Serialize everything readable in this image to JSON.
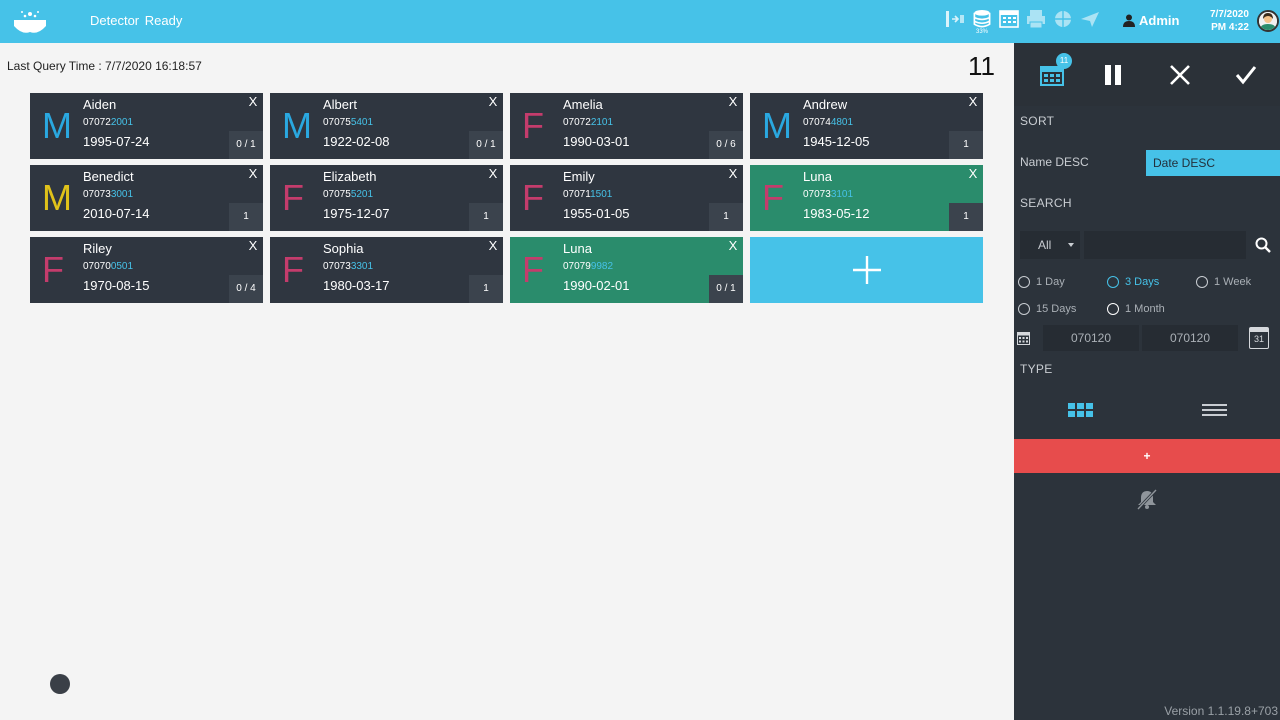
{
  "topbar": {
    "status": "Detector  Ready",
    "disk_usage": "33%",
    "user": "Admin",
    "date": "7/7/2020",
    "time": "PM 4:22",
    "icons": [
      "detector-signal-icon",
      "database-icon",
      "calendar-grid-icon",
      "printer-icon",
      "network-icon",
      "send-icon",
      "user-icon",
      "avatar"
    ]
  },
  "main": {
    "last_query": "Last Query Time : 7/7/2020 16:18:57",
    "total_count": "11",
    "close_label": "X"
  },
  "cards": [
    {
      "initial": "M",
      "initial_color": "#2aa8e0",
      "name": "Aiden",
      "id_prefix": "07072",
      "id_suffix": "2001",
      "dob": "1995-07-24",
      "count": "0 / 1",
      "highlight": false
    },
    {
      "initial": "M",
      "initial_color": "#2aa8e0",
      "name": "Albert",
      "id_prefix": "07075",
      "id_suffix": "5401",
      "dob": "1922-02-08",
      "count": "0 / 1",
      "highlight": false
    },
    {
      "initial": "F",
      "initial_color": "#c43c6c",
      "name": "Amelia",
      "id_prefix": "07072",
      "id_suffix": "2101",
      "dob": "1990-03-01",
      "count": "0 / 6",
      "highlight": false
    },
    {
      "initial": "M",
      "initial_color": "#2aa8e0",
      "name": "Andrew",
      "id_prefix": "07074",
      "id_suffix": "4801",
      "dob": "1945-12-05",
      "count": "1",
      "highlight": false
    },
    {
      "initial": "M",
      "initial_color": "#e0c21a",
      "name": "Benedict",
      "id_prefix": "07073",
      "id_suffix": "3001",
      "dob": "2010-07-14",
      "count": "1",
      "highlight": false
    },
    {
      "initial": "F",
      "initial_color": "#c43c6c",
      "name": "Elizabeth",
      "id_prefix": "07075",
      "id_suffix": "5201",
      "dob": "1975-12-07",
      "count": "1",
      "highlight": false
    },
    {
      "initial": "F",
      "initial_color": "#c43c6c",
      "name": "Emily",
      "id_prefix": "07071",
      "id_suffix": "1501",
      "dob": "1955-01-05",
      "count": "1",
      "highlight": false
    },
    {
      "initial": "F",
      "initial_color": "#c43c6c",
      "name": "Luna",
      "id_prefix": "07073",
      "id_suffix": "3101",
      "dob": "1983-05-12",
      "count": "1",
      "highlight": true
    },
    {
      "initial": "F",
      "initial_color": "#c43c6c",
      "name": "Riley",
      "id_prefix": "07070",
      "id_suffix": "0501",
      "dob": "1970-08-15",
      "count": "0 / 4",
      "highlight": false
    },
    {
      "initial": "F",
      "initial_color": "#c43c6c",
      "name": "Sophia",
      "id_prefix": "07073",
      "id_suffix": "3301",
      "dob": "1980-03-17",
      "count": "1",
      "highlight": false
    },
    {
      "initial": "F",
      "initial_color": "#c43c6c",
      "name": "Luna",
      "id_prefix": "07079",
      "id_suffix": "9982",
      "dob": "1990-02-01",
      "count": "0 / 1",
      "highlight": true
    }
  ],
  "panel": {
    "badge": "11",
    "sort_label": "SORT",
    "sort_name": "Name DESC",
    "sort_date": "Date DESC",
    "search_label": "SEARCH",
    "search_scope": "All",
    "search_value": "",
    "ranges": [
      {
        "label": "1 Day",
        "selected": false
      },
      {
        "label": "3 Days",
        "selected": true
      },
      {
        "label": "1 Week",
        "selected": false
      },
      {
        "label": "15 Days",
        "selected": false
      },
      {
        "label": "1 Month",
        "selected": false
      }
    ],
    "date_from": "070120",
    "date_to": "070120",
    "calendar_day": "31",
    "type_label": "TYPE",
    "alert_label": "+",
    "version": "Version 1.1.19.8+703"
  },
  "colors": {
    "accent": "#46c2e8",
    "card": "#2f3640",
    "card_highlight": "#2a8c6c",
    "alert": "#e74c4c",
    "male": "#2aa8e0",
    "female": "#c43c6c",
    "child": "#e0c21a"
  }
}
